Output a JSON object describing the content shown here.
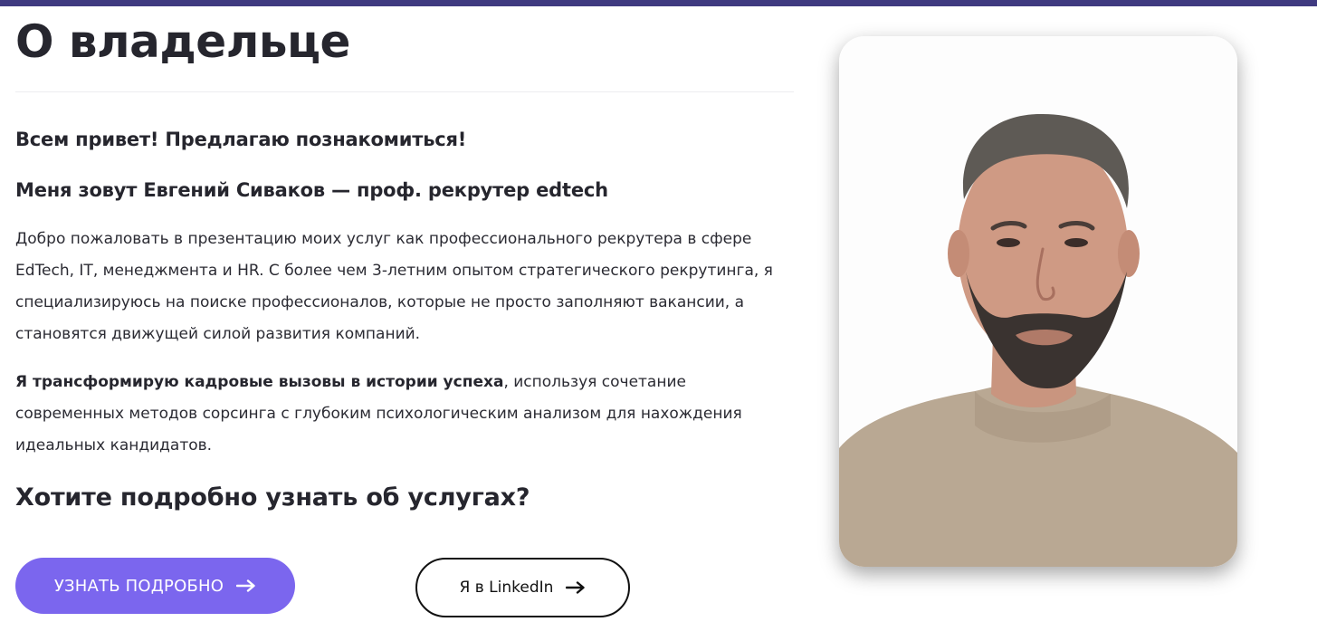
{
  "page": {
    "title": "О владельце"
  },
  "about": {
    "greeting": "Всем привет! Предлагаю познакомиться!",
    "intro": "Меня зовут Евгений Сиваков — проф. рекрутер edtech",
    "paragraph1": "Добро пожаловать в презентацию моих услуг как профессионального рекрутера в сфере EdTech, IT, менеджмента и HR. С более чем 3-летним опытом стратегического рекрутинга, я специализируюсь на поиске профессионалов, которые не просто заполняют вакансии, а становятся движущей силой развития компаний.",
    "paragraph2_bold": "Я трансформирую кадровые вызовы в истории успеха",
    "paragraph2_rest": ", используя сочетание современных методов сорсинга с глубоким психологическим анализом для нахождения идеальных кандидатов.",
    "cta_heading": "Хотите подробно узнать об услугах?"
  },
  "buttons": {
    "learn_more": "УЗНАТЬ ПОДРОБНО",
    "linkedin": "Я в LinkedIn"
  },
  "icons": {
    "arrow": "arrow-right-icon",
    "photo": "owner-photo"
  },
  "colors": {
    "top_bar": "#3f3a80",
    "primary_button": "#7b66ee",
    "text": "#26262e"
  }
}
